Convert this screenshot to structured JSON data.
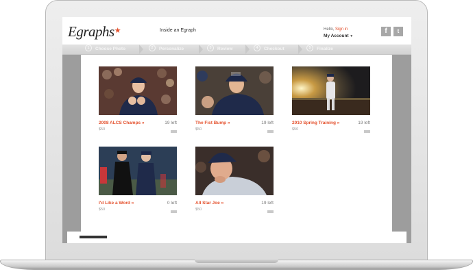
{
  "site": {
    "logo_text": "Egraphs",
    "logo_star": "★",
    "inside_link": "Inside an Egraph",
    "hello_text": "Hello,",
    "signin_text": "Sign in",
    "account_text": "My Account",
    "account_caret": "▼",
    "facebook_icon": "f",
    "twitter_icon": "t"
  },
  "steps": [
    {
      "num": "1",
      "label": "Choose Photo"
    },
    {
      "num": "2",
      "label": "Personalize"
    },
    {
      "num": "3",
      "label": "Review"
    },
    {
      "num": "4",
      "label": "Checkout"
    },
    {
      "num": "5",
      "label": "Finalize"
    }
  ],
  "products": [
    {
      "title": "2008 ALCS Champs »",
      "left": "19 left",
      "price": "$50"
    },
    {
      "title": "The Fist Bump »",
      "left": "19 left",
      "price": "$50"
    },
    {
      "title": "2010 Spring Training »",
      "left": "19 left",
      "price": "$50"
    },
    {
      "title": "I'd Like a Word »",
      "left": "0 left",
      "price": "$50"
    },
    {
      "title": "All Star Joe »",
      "left": "19 left",
      "price": "$50"
    }
  ],
  "colors": {
    "accent": "#e4502c",
    "screen_bg": "#9d9d9d",
    "steps_bg": "#d8d8d8"
  }
}
